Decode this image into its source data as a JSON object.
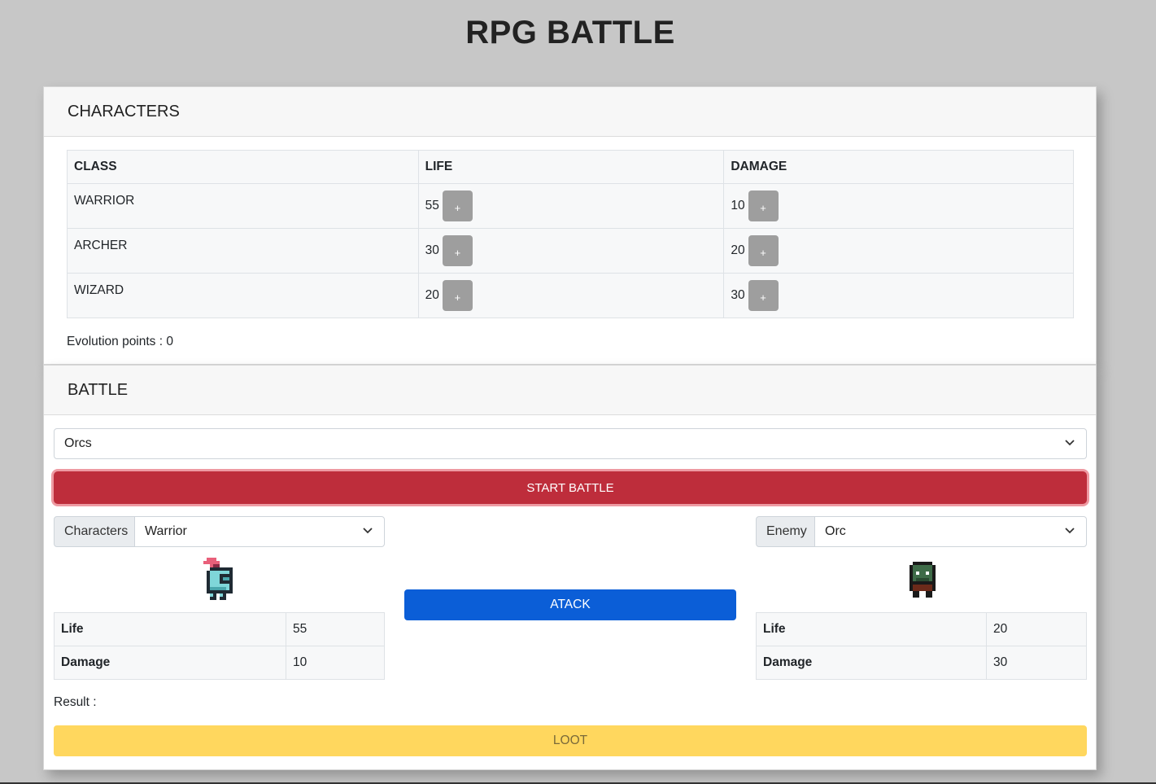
{
  "title": "RPG BATTLE",
  "characters": {
    "header": "CHARACTERS",
    "columns": [
      "CLASS",
      "LIFE",
      "DAMAGE"
    ],
    "rows": [
      {
        "class": "WARRIOR",
        "life": "55",
        "damage": "10"
      },
      {
        "class": "ARCHER",
        "life": "30",
        "damage": "20"
      },
      {
        "class": "WIZARD",
        "life": "20",
        "damage": "30"
      }
    ],
    "plus_label": "+",
    "evolution_points": "Evolution points : 0"
  },
  "battle": {
    "header": "BATTLE",
    "enemy_group": "Orcs",
    "start_label": "START BATTLE",
    "character_addon": "Characters",
    "character_selected": "Warrior",
    "enemy_addon": "Enemy",
    "enemy_selected": "Orc",
    "attack_label": "ATACK",
    "char_stats": {
      "life_label": "Life",
      "life": "55",
      "damage_label": "Damage",
      "damage": "10"
    },
    "enemy_stats": {
      "life_label": "Life",
      "life": "20",
      "damage_label": "Damage",
      "damage": "30"
    },
    "result_label": "Result :",
    "loot_label": "LOOT"
  },
  "icons": {
    "chevron": "chevron-down-icon",
    "character_sprite": "knight-sprite-icon",
    "enemy_sprite": "orc-sprite-icon"
  },
  "colors": {
    "background": "#c7c7c7",
    "start_battle": "#be2d3b",
    "attack": "#0b5ed7",
    "loot": "#ffd75e",
    "plus_button": "#9e9e9e"
  }
}
